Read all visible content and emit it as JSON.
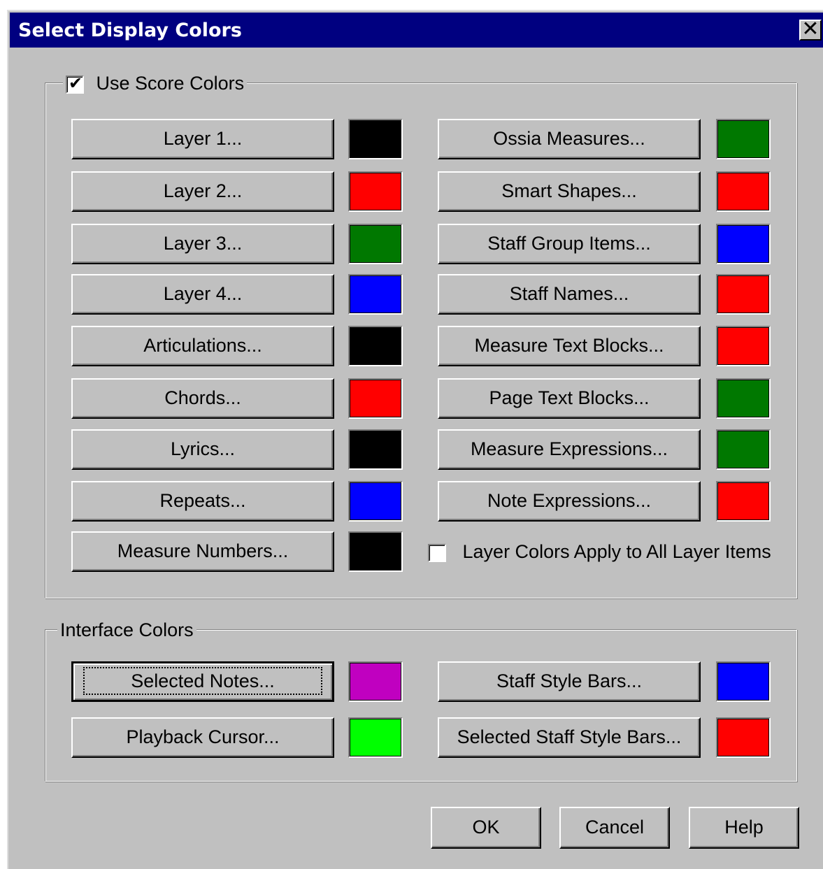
{
  "title": "Select Display Colors",
  "close_symbol": "✕",
  "score_group": {
    "legend": "Use Score Colors",
    "checked": true,
    "check_mark": "✔",
    "left_items": [
      {
        "label": "Layer 1...",
        "color": "#000000"
      },
      {
        "label": "Layer 2...",
        "color": "#ff0000"
      },
      {
        "label": "Layer 3...",
        "color": "#007800"
      },
      {
        "label": "Layer 4...",
        "color": "#0000ff"
      },
      {
        "label": "Articulations...",
        "color": "#000000"
      },
      {
        "label": "Chords...",
        "color": "#ff0000"
      },
      {
        "label": "Lyrics...",
        "color": "#000000"
      },
      {
        "label": "Repeats...",
        "color": "#0000ff"
      },
      {
        "label": "Measure Numbers...",
        "color": "#000000"
      }
    ],
    "right_items": [
      {
        "label": "Ossia Measures...",
        "color": "#007800"
      },
      {
        "label": "Smart Shapes...",
        "color": "#ff0000"
      },
      {
        "label": "Staff Group Items...",
        "color": "#0000ff"
      },
      {
        "label": "Staff Names...",
        "color": "#ff0000"
      },
      {
        "label": "Measure Text Blocks...",
        "color": "#ff0000"
      },
      {
        "label": "Page Text Blocks...",
        "color": "#007800"
      },
      {
        "label": "Measure Expressions...",
        "color": "#007800"
      },
      {
        "label": "Note Expressions...",
        "color": "#ff0000"
      }
    ],
    "layer_checkbox": {
      "label": "Layer Colors Apply to All Layer Items",
      "checked": false
    }
  },
  "interface_group": {
    "legend": "Interface Colors",
    "left_items": [
      {
        "label": "Selected Notes...",
        "color": "#c000c0"
      },
      {
        "label": "Playback Cursor...",
        "color": "#00ff00"
      }
    ],
    "right_items": [
      {
        "label": "Staff Style Bars...",
        "color": "#0000ff"
      },
      {
        "label": "Selected Staff Style Bars...",
        "color": "#ff0000"
      }
    ]
  },
  "buttons": {
    "ok": "OK",
    "cancel": "Cancel",
    "help": "Help"
  }
}
